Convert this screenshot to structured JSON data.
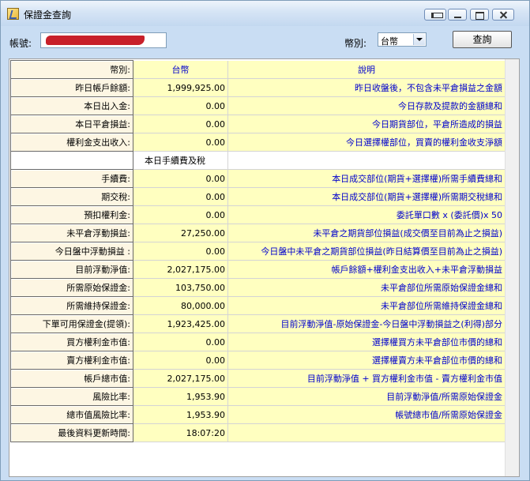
{
  "window": {
    "title": "保證金查詢"
  },
  "toolbar": {
    "account_label": "帳號:",
    "currency_label": "幣別:",
    "currency_value": "台幣",
    "query_button": "查詢"
  },
  "table": {
    "header": {
      "label": "幣別:",
      "currency": "台幣",
      "desc": "說明"
    },
    "rows_top": [
      {
        "label": "昨日帳戶餘額:",
        "value": "1,999,925.00",
        "desc": "昨日收盤後，不包含未平倉損益之金額"
      },
      {
        "label": "本日出入金:",
        "value": "0.00",
        "desc": "今日存款及提款的金額總和"
      },
      {
        "label": "本日平倉損益:",
        "value": "0.00",
        "desc": "今日期貨部位，平倉所造成的損益"
      },
      {
        "label": "權利金支出收入:",
        "value": "0.00",
        "desc": "今日選擇權部位，買賣的權利金收支淨額"
      }
    ],
    "section_title": "本日手續費及稅",
    "rows_bottom": [
      {
        "label": "手續費:",
        "value": "0.00",
        "desc": "本日成交部位(期貨+選擇權)所需手續費總和"
      },
      {
        "label": "期交稅:",
        "value": "0.00",
        "desc": "本日成交部位(期貨+選擇權)所需期交稅總和"
      },
      {
        "label": "預扣權利金:",
        "value": "0.00",
        "desc": "委託單口數 x (委託價)x 50"
      },
      {
        "label": "未平倉浮動損益:",
        "value": "27,250.00",
        "desc": "未平倉之期貨部位損益(成交價至目前為止之損益)"
      },
      {
        "label": "今日盤中浮動損益 :",
        "value": "0.00",
        "desc": "今日盤中未平倉之期貨部位損益(昨日結算價至目前為止之損益)"
      },
      {
        "label": "目前浮動淨值:",
        "value": "2,027,175.00",
        "desc": "帳戶餘額+權利金支出收入+未平倉浮動損益"
      },
      {
        "label": "所需原始保證金:",
        "value": "103,750.00",
        "desc": "未平倉部位所需原始保證金總和"
      },
      {
        "label": "所需維持保證金:",
        "value": "80,000.00",
        "desc": "未平倉部位所需維持保證金總和"
      },
      {
        "label": "下單可用保證金(提領):",
        "value": "1,923,425.00",
        "desc": "目前浮動淨值-原始保證金-今日盤中浮動損益之(利得)部分"
      },
      {
        "label": "買方權利金市值:",
        "value": "0.00",
        "desc": "選擇權買方未平倉部位市價的總和"
      },
      {
        "label": "賣方權利金市值:",
        "value": "0.00",
        "desc": "選擇權賣方未平倉部位市價的總和"
      },
      {
        "label": "帳戶總市值:",
        "value": "2,027,175.00",
        "desc": "目前浮動淨值 + 買方權利金市值 - 賣方權利金市值"
      },
      {
        "label": "風險比率:",
        "value": "1,953.90",
        "desc": "目前浮動淨值/所需原始保證金"
      },
      {
        "label": "總市值風險比率:",
        "value": "1,953.90",
        "desc": "帳號總市值/所需原始保證金"
      },
      {
        "label": "最後資料更新時間:",
        "value": "18:07:20",
        "desc": ""
      }
    ]
  }
}
